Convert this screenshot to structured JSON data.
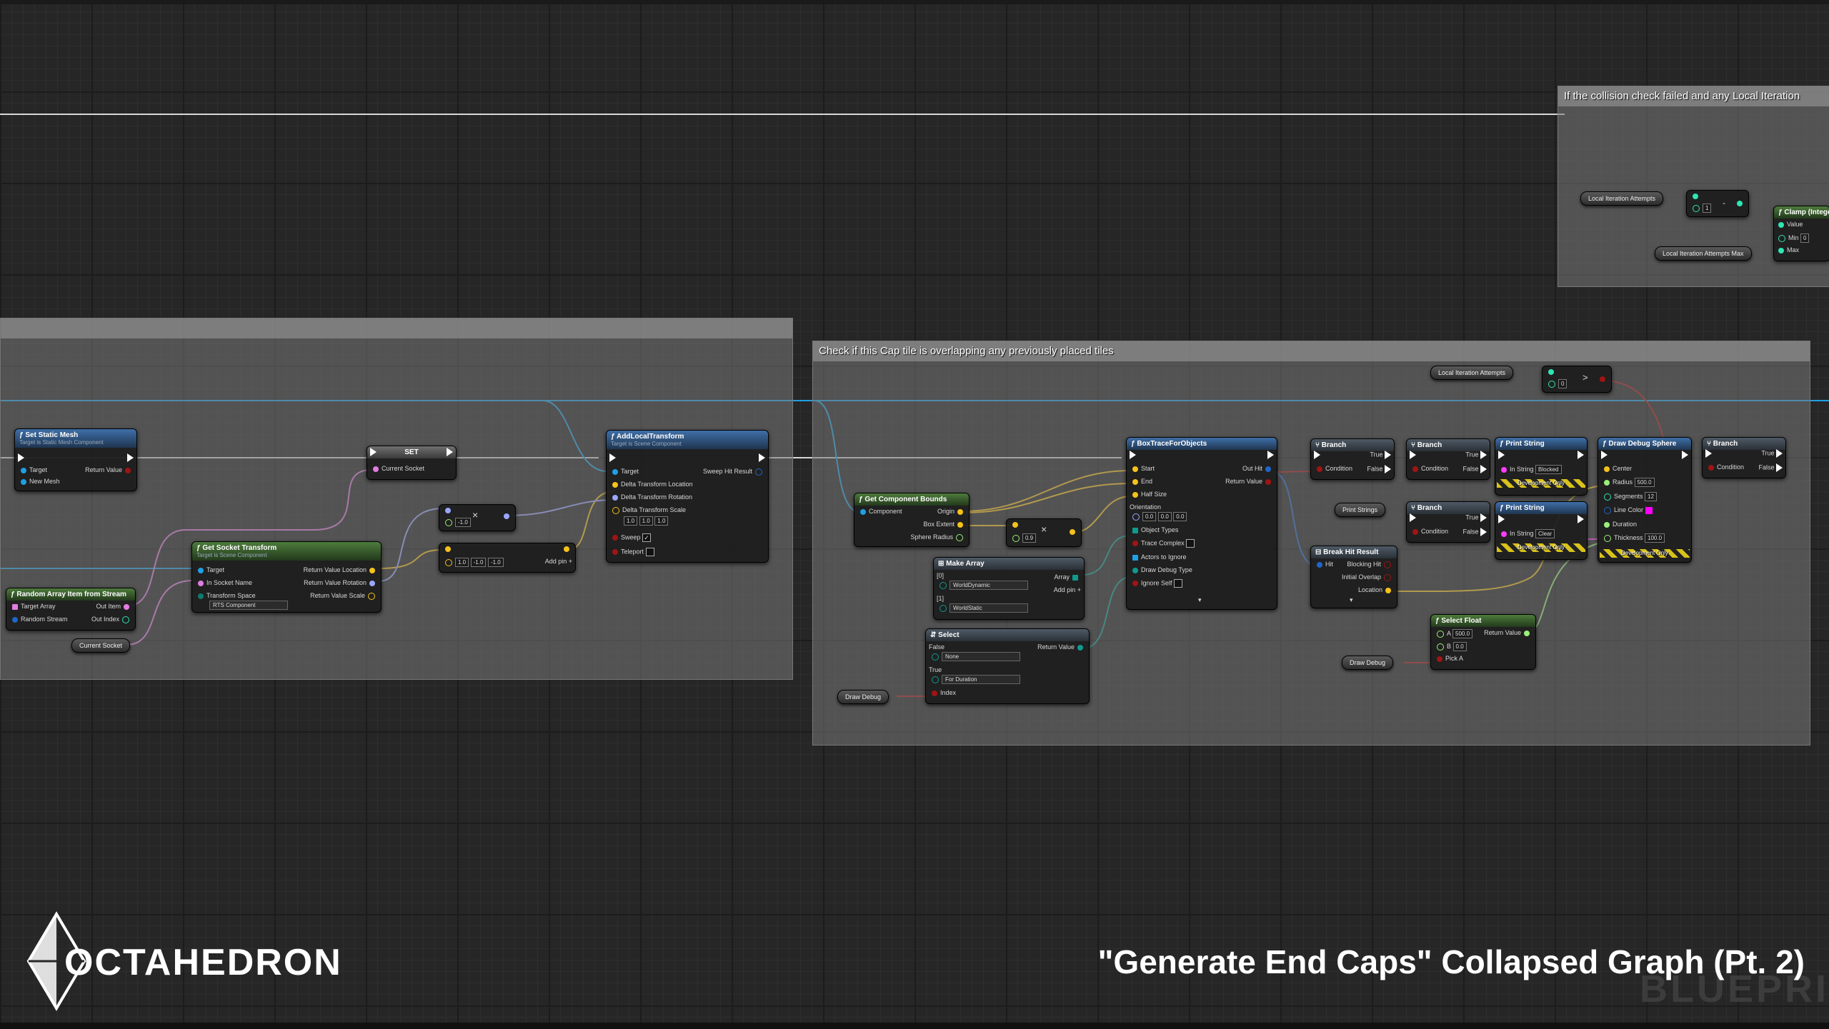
{
  "comments": {
    "top_right": "If the collision check failed and any Local Iteration",
    "overlap": "Check if this Cap tile is overlapping any previously placed tiles",
    "left": ""
  },
  "nodes": {
    "set_static_mesh": {
      "title": "Set Static Mesh",
      "subtitle": "Target is Static Mesh Component",
      "pin_target": "Target",
      "pin_new_mesh": "New Mesh",
      "pin_return": "Return Value"
    },
    "random_array": {
      "title": "Random Array Item from Stream",
      "pin_target_array": "Target Array",
      "pin_random_stream": "Random Stream",
      "pin_out_item": "Out Item",
      "pin_out_index": "Out Index"
    },
    "current_socket_var": "Current Socket",
    "set_node": {
      "title": "SET",
      "pin": "Current Socket"
    },
    "get_socket_transform": {
      "title": "Get Socket Transform",
      "subtitle": "Target is Scene Component",
      "pin_target": "Target",
      "pin_socket": "In Socket Name",
      "pin_space": "Transform Space",
      "space_value": "RTS Component",
      "ret_loc": "Return Value Location",
      "ret_rot": "Return Value Rotation",
      "ret_scale": "Return Value Scale"
    },
    "multiply_float": {
      "value": "-1.0",
      "symbol": "×"
    },
    "make_vector": {
      "x": "1.0",
      "y": "-1.0",
      "z": "-1.0",
      "add_pin": "Add pin"
    },
    "add_local_transform": {
      "title": "AddLocalTransform",
      "subtitle": "Target is Scene Component",
      "pin_target": "Target",
      "pin_loc": "Delta Transform Location",
      "pin_rot": "Delta Transform Rotation",
      "pin_scale": "Delta Transform Scale",
      "scale_x": "1.0",
      "scale_y": "1.0",
      "scale_z": "1.0",
      "pin_sweep": "Sweep",
      "pin_teleport": "Teleport",
      "pin_sweep_hit": "Sweep Hit Result"
    },
    "local_iter_1": "Local Iteration Attempts",
    "local_iter_2": "Local Iteration Attempts",
    "local_iter_max": "Local Iteration Attempts Max",
    "compare_greater": {
      "value": "0",
      "symbol": ">"
    },
    "minus_node": {
      "value": "1",
      "symbol": "-"
    },
    "clamp": {
      "title": "Clamp (Integer)",
      "pin_value": "Value",
      "pin_min": "Min",
      "min_value": "0",
      "pin_max": "Max"
    },
    "get_component_bounds": {
      "title": "Get Component Bounds",
      "pin_component": "Component",
      "pin_origin": "Origin",
      "pin_box_extent": "Box Extent",
      "pin_sphere_radius": "Sphere Radius"
    },
    "multiply_vector": {
      "value": "0.9",
      "symbol": "×"
    },
    "make_array": {
      "title": "Make Array",
      "idx0": "[0]",
      "val0": "WorldDynamic",
      "idx1": "[1]",
      "val1": "WorldStatic",
      "pin_array": "Array",
      "add_pin": "Add pin"
    },
    "select": {
      "title": "Select",
      "pin_false": "False",
      "false_value": "None",
      "pin_true": "True",
      "true_value": "For Duration",
      "pin_index": "Index",
      "pin_return": "Return Value"
    },
    "draw_debug_var_1": "Draw Debug",
    "draw_debug_var_2": "Draw Debug",
    "box_trace": {
      "title": "BoxTraceForObjects",
      "pin_start": "Start",
      "pin_end": "End",
      "pin_half_size": "Half Size",
      "pin_orientation": "Orientation",
      "ox": "0.0",
      "oy": "0.0",
      "oz": "0.0",
      "pin_object_types": "Object Types",
      "pin_trace_complex": "Trace Complex",
      "pin_actors_ignore": "Actors to Ignore",
      "pin_draw_debug": "Draw Debug Type",
      "pin_ignore_self": "Ignore Self",
      "pin_out_hit": "Out Hit",
      "pin_return": "Return Value"
    },
    "branch_1": {
      "title": "Branch",
      "pin_condition": "Condition",
      "pin_true": "True",
      "pin_false": "False"
    },
    "branch_2": {
      "title": "Branch",
      "pin_condition": "Condition",
      "pin_true": "True",
      "pin_false": "False"
    },
    "branch_3": {
      "title": "Branch",
      "pin_condition": "Condition",
      "pin_true": "True",
      "pin_false": "False"
    },
    "branch_4": {
      "title": "Branch",
      "pin_condition": "Condition",
      "pin_true": "True",
      "pin_false": "False"
    },
    "print_strings_var": "Print Strings",
    "break_hit_result": {
      "title": "Break Hit Result",
      "pin_hit": "Hit",
      "pin_blocking": "Blocking Hit",
      "pin_initial": "Initial Overlap",
      "pin_location": "Location"
    },
    "print_string_1": {
      "title": "Print String",
      "pin_in_string": "In String",
      "value": "Blocked",
      "dev_only": "Development Only"
    },
    "print_string_2": {
      "title": "Print String",
      "pin_in_string": "In String",
      "value": "Clear",
      "dev_only": "Development Only"
    },
    "select_float": {
      "title": "Select Float",
      "pin_a": "A",
      "a_value": "500.0",
      "pin_b": "B",
      "b_value": "0.0",
      "pin_pick_a": "Pick A",
      "pin_return": "Return Value"
    },
    "draw_debug_sphere": {
      "title": "Draw Debug Sphere",
      "pin_center": "Center",
      "pin_radius": "Radius",
      "radius_value": "500.0",
      "pin_segments": "Segments",
      "segments_value": "12",
      "pin_line_color": "Line Color",
      "pin_duration": "Duration",
      "pin_thickness": "Thickness",
      "thickness_value": "100.0",
      "dev_only": "Development Only"
    }
  },
  "footer": {
    "brand": "OCTAHEDRON",
    "caption": "\"Generate End Caps\" Collapsed Graph (Pt. 2)",
    "watermark": "BLUEPRI"
  },
  "colors": {
    "exec": "#ffffff",
    "object": "#1ea0e6",
    "vector": "#f5c21a",
    "rotator": "#9aa7ff",
    "transform": "#f08a1e",
    "string": "#ff3cff",
    "bool": "#a01414",
    "float": "#9bf07a",
    "struct": "#1e66c8",
    "byte": "#0f7a6e",
    "int": "#2ee6b4",
    "line_color": "#ff00ff"
  }
}
